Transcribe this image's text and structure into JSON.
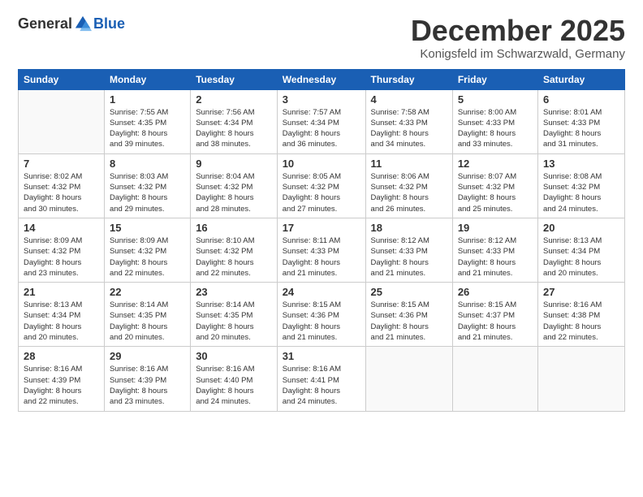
{
  "logo": {
    "general": "General",
    "blue": "Blue"
  },
  "title": "December 2025",
  "location": "Konigsfeld im Schwarzwald, Germany",
  "weekdays": [
    "Sunday",
    "Monday",
    "Tuesday",
    "Wednesday",
    "Thursday",
    "Friday",
    "Saturday"
  ],
  "weeks": [
    [
      {
        "day": "",
        "info": ""
      },
      {
        "day": "1",
        "info": "Sunrise: 7:55 AM\nSunset: 4:35 PM\nDaylight: 8 hours\nand 39 minutes."
      },
      {
        "day": "2",
        "info": "Sunrise: 7:56 AM\nSunset: 4:34 PM\nDaylight: 8 hours\nand 38 minutes."
      },
      {
        "day": "3",
        "info": "Sunrise: 7:57 AM\nSunset: 4:34 PM\nDaylight: 8 hours\nand 36 minutes."
      },
      {
        "day": "4",
        "info": "Sunrise: 7:58 AM\nSunset: 4:33 PM\nDaylight: 8 hours\nand 34 minutes."
      },
      {
        "day": "5",
        "info": "Sunrise: 8:00 AM\nSunset: 4:33 PM\nDaylight: 8 hours\nand 33 minutes."
      },
      {
        "day": "6",
        "info": "Sunrise: 8:01 AM\nSunset: 4:33 PM\nDaylight: 8 hours\nand 31 minutes."
      }
    ],
    [
      {
        "day": "7",
        "info": "Sunrise: 8:02 AM\nSunset: 4:32 PM\nDaylight: 8 hours\nand 30 minutes."
      },
      {
        "day": "8",
        "info": "Sunrise: 8:03 AM\nSunset: 4:32 PM\nDaylight: 8 hours\nand 29 minutes."
      },
      {
        "day": "9",
        "info": "Sunrise: 8:04 AM\nSunset: 4:32 PM\nDaylight: 8 hours\nand 28 minutes."
      },
      {
        "day": "10",
        "info": "Sunrise: 8:05 AM\nSunset: 4:32 PM\nDaylight: 8 hours\nand 27 minutes."
      },
      {
        "day": "11",
        "info": "Sunrise: 8:06 AM\nSunset: 4:32 PM\nDaylight: 8 hours\nand 26 minutes."
      },
      {
        "day": "12",
        "info": "Sunrise: 8:07 AM\nSunset: 4:32 PM\nDaylight: 8 hours\nand 25 minutes."
      },
      {
        "day": "13",
        "info": "Sunrise: 8:08 AM\nSunset: 4:32 PM\nDaylight: 8 hours\nand 24 minutes."
      }
    ],
    [
      {
        "day": "14",
        "info": "Sunrise: 8:09 AM\nSunset: 4:32 PM\nDaylight: 8 hours\nand 23 minutes."
      },
      {
        "day": "15",
        "info": "Sunrise: 8:09 AM\nSunset: 4:32 PM\nDaylight: 8 hours\nand 22 minutes."
      },
      {
        "day": "16",
        "info": "Sunrise: 8:10 AM\nSunset: 4:32 PM\nDaylight: 8 hours\nand 22 minutes."
      },
      {
        "day": "17",
        "info": "Sunrise: 8:11 AM\nSunset: 4:33 PM\nDaylight: 8 hours\nand 21 minutes."
      },
      {
        "day": "18",
        "info": "Sunrise: 8:12 AM\nSunset: 4:33 PM\nDaylight: 8 hours\nand 21 minutes."
      },
      {
        "day": "19",
        "info": "Sunrise: 8:12 AM\nSunset: 4:33 PM\nDaylight: 8 hours\nand 21 minutes."
      },
      {
        "day": "20",
        "info": "Sunrise: 8:13 AM\nSunset: 4:34 PM\nDaylight: 8 hours\nand 20 minutes."
      }
    ],
    [
      {
        "day": "21",
        "info": "Sunrise: 8:13 AM\nSunset: 4:34 PM\nDaylight: 8 hours\nand 20 minutes."
      },
      {
        "day": "22",
        "info": "Sunrise: 8:14 AM\nSunset: 4:35 PM\nDaylight: 8 hours\nand 20 minutes."
      },
      {
        "day": "23",
        "info": "Sunrise: 8:14 AM\nSunset: 4:35 PM\nDaylight: 8 hours\nand 20 minutes."
      },
      {
        "day": "24",
        "info": "Sunrise: 8:15 AM\nSunset: 4:36 PM\nDaylight: 8 hours\nand 21 minutes."
      },
      {
        "day": "25",
        "info": "Sunrise: 8:15 AM\nSunset: 4:36 PM\nDaylight: 8 hours\nand 21 minutes."
      },
      {
        "day": "26",
        "info": "Sunrise: 8:15 AM\nSunset: 4:37 PM\nDaylight: 8 hours\nand 21 minutes."
      },
      {
        "day": "27",
        "info": "Sunrise: 8:16 AM\nSunset: 4:38 PM\nDaylight: 8 hours\nand 22 minutes."
      }
    ],
    [
      {
        "day": "28",
        "info": "Sunrise: 8:16 AM\nSunset: 4:39 PM\nDaylight: 8 hours\nand 22 minutes."
      },
      {
        "day": "29",
        "info": "Sunrise: 8:16 AM\nSunset: 4:39 PM\nDaylight: 8 hours\nand 23 minutes."
      },
      {
        "day": "30",
        "info": "Sunrise: 8:16 AM\nSunset: 4:40 PM\nDaylight: 8 hours\nand 24 minutes."
      },
      {
        "day": "31",
        "info": "Sunrise: 8:16 AM\nSunset: 4:41 PM\nDaylight: 8 hours\nand 24 minutes."
      },
      {
        "day": "",
        "info": ""
      },
      {
        "day": "",
        "info": ""
      },
      {
        "day": "",
        "info": ""
      }
    ]
  ]
}
